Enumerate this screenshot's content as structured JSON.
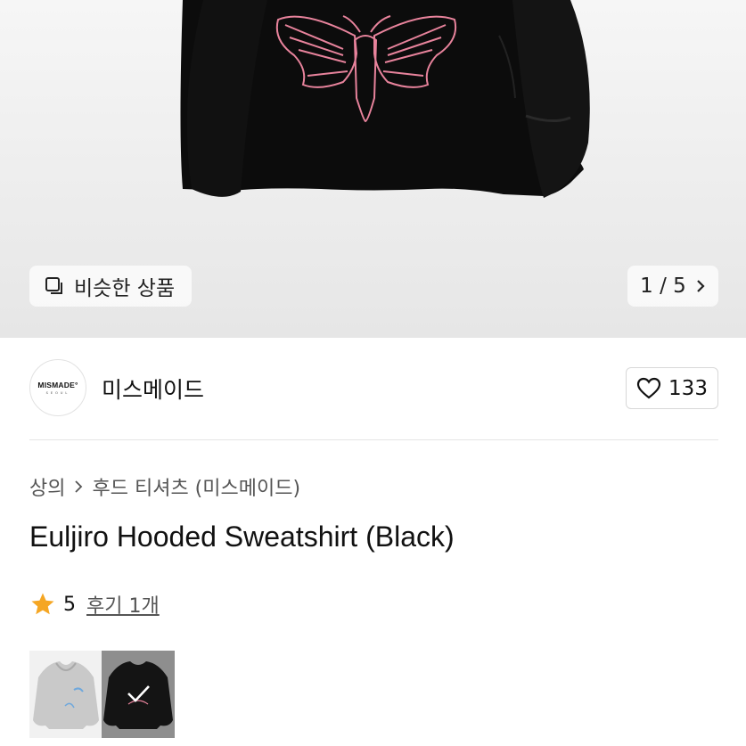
{
  "hero": {
    "similar_label": "비슷한 상품",
    "counter": "1 / 5",
    "colors": {
      "hoodie": "#0c0c0c",
      "embroidery": "#e8839c"
    }
  },
  "brand": {
    "logo_text": "MISMADE°",
    "logo_sub": "SEOUL",
    "name": "미스메이드",
    "likes": "133"
  },
  "breadcrumb": {
    "category": "상의",
    "subcategory": "후드 티셔츠 (미스메이드)"
  },
  "product": {
    "title": "Euljiro Hooded Sweatshirt (Black)"
  },
  "rating": {
    "score": "5",
    "reviews": "후기 1개",
    "star_color": "#f5a623"
  },
  "thumbnails": [
    {
      "name": "grey-hoodie-thumbnail",
      "selected": false
    },
    {
      "name": "black-hoodie-thumbnail",
      "selected": true
    }
  ]
}
